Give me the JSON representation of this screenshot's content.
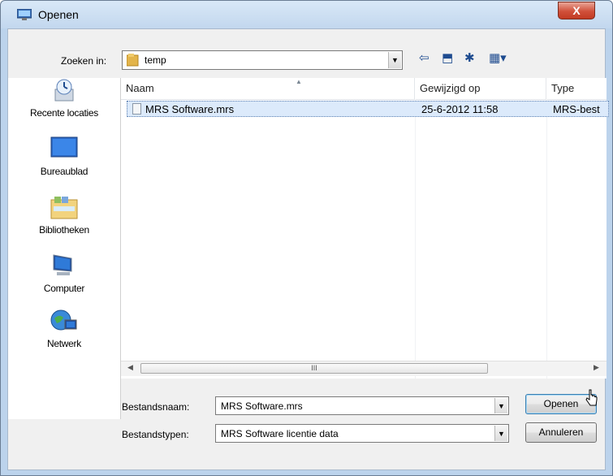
{
  "window": {
    "title": "Openen",
    "close_label": "X"
  },
  "lookin": {
    "label": "Zoeken in:",
    "value": "temp"
  },
  "toolbar": {
    "icons": [
      "back-arrow-icon",
      "up-folder-icon",
      "new-folder-icon",
      "view-menu-icon"
    ]
  },
  "places": [
    {
      "label": "Recente locaties",
      "icon": "recent-places-icon"
    },
    {
      "label": "Bureaublad",
      "icon": "desktop-icon"
    },
    {
      "label": "Bibliotheken",
      "icon": "libraries-icon"
    },
    {
      "label": "Computer",
      "icon": "computer-icon"
    },
    {
      "label": "Netwerk",
      "icon": "network-icon"
    }
  ],
  "columns": {
    "name": "Naam",
    "modified": "Gewijzigd op",
    "type": "Type"
  },
  "files": [
    {
      "name": "MRS Software.mrs",
      "modified": "25-6-2012 11:58",
      "type": "MRS-best"
    }
  ],
  "scrollbar": {
    "grip": "III"
  },
  "filename": {
    "label": "Bestandsnaam:",
    "value": "MRS Software.mrs"
  },
  "filetype": {
    "label": "Bestandstypen:",
    "value": "MRS Software licentie data"
  },
  "buttons": {
    "open": "Openen",
    "cancel": "Annuleren"
  }
}
